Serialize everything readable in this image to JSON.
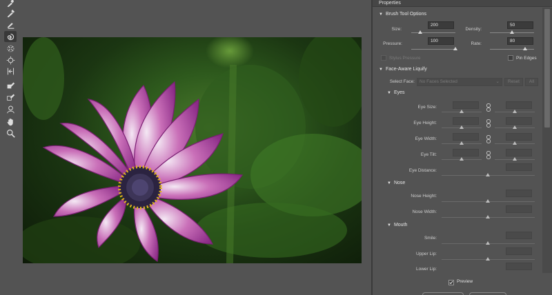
{
  "panel": {
    "title": "Properties"
  },
  "brush_options": {
    "title": "Brush Tool Options",
    "size_label": "Size:",
    "size_value": "200",
    "size_level": 0.2,
    "density_label": "Density:",
    "density_value": "50",
    "density_level": 0.5,
    "pressure_label": "Pressure:",
    "pressure_value": "100",
    "pressure_level": 1.0,
    "rate_label": "Rate:",
    "rate_value": "80",
    "rate_level": 0.8,
    "stylus_label": "Stylus Pressure",
    "pin_edges_label": "Pin Edges"
  },
  "face_liquify": {
    "title": "Face-Aware Liquify",
    "select_face_label": "Select Face:",
    "select_face_placeholder": "No Faces Selected",
    "reset_label": "Reset",
    "all_label": "All",
    "eyes": {
      "title": "Eyes",
      "size_label": "Eye Size:",
      "height_label": "Eye Height:",
      "width_label": "Eye Width:",
      "tilt_label": "Eye Tilt:",
      "distance_label": "Eye Distance:"
    },
    "nose": {
      "title": "Nose",
      "height_label": "Nose Height:",
      "width_label": "Nose Width:"
    },
    "mouth": {
      "title": "Mouth",
      "smile_label": "Smile:",
      "upper_lip_label": "Upper Lip:",
      "lower_lip_label": "Lower Lip:"
    }
  },
  "preview": {
    "label": "Preview",
    "checked": true
  },
  "tools": [
    "forward-warp-icon",
    "reconstruct-icon",
    "smooth-icon",
    "twirl-icon",
    "pucker-icon",
    "bloat-icon",
    "push-left-icon",
    "freeze-mask-icon",
    "thaw-mask-icon",
    "face-tool-icon",
    "hand-icon",
    "zoom-icon"
  ],
  "colors": {
    "panel": "#535353",
    "field": "#3b3b3b",
    "flower_petal": "#b0489a",
    "flower_center": "#2b2340"
  }
}
